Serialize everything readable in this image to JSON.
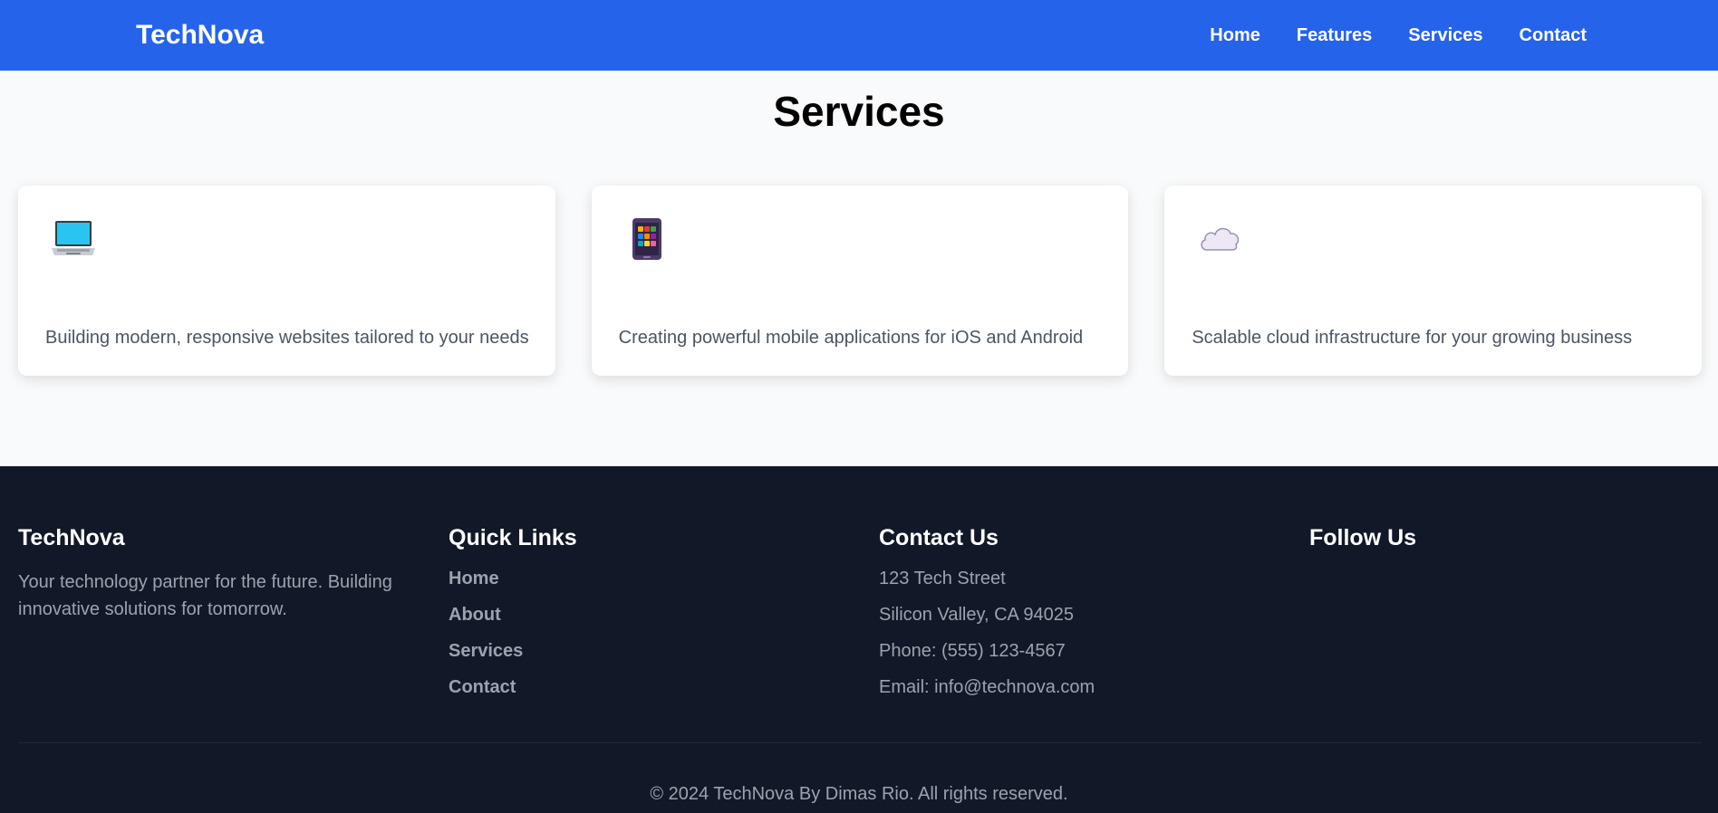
{
  "navbar": {
    "brand": "TechNova",
    "links": [
      {
        "label": "Home"
      },
      {
        "label": "Features"
      },
      {
        "label": "Services"
      },
      {
        "label": "Contact"
      }
    ]
  },
  "services": {
    "title": "Services",
    "cards": [
      {
        "icon": "laptop-icon",
        "text": "Building modern, responsive websites tailored to your needs"
      },
      {
        "icon": "mobile-phone-icon",
        "text": "Creating powerful mobile applications for iOS and Android"
      },
      {
        "icon": "cloud-icon",
        "text": "Scalable cloud infrastructure for your growing business"
      }
    ]
  },
  "footer": {
    "about": {
      "title": "TechNova",
      "description": "Your technology partner for the future. Building innovative solutions for tomorrow."
    },
    "quick_links": {
      "title": "Quick Links",
      "items": [
        {
          "label": "Home"
        },
        {
          "label": "About"
        },
        {
          "label": "Services"
        },
        {
          "label": "Contact"
        }
      ]
    },
    "contact": {
      "title": "Contact Us",
      "address_line1": "123 Tech Street",
      "address_line2": "Silicon Valley, CA 94025",
      "phone": "Phone: (555) 123-4567",
      "email": "Email: info@technova.com"
    },
    "follow": {
      "title": "Follow Us"
    },
    "copyright": "© 2024 TechNova By Dimas Rio. All rights reserved."
  },
  "colors": {
    "primary": "#2563eb",
    "page_background": "#f9fafb",
    "footer_background": "#111827",
    "muted_text": "#9ca3af",
    "card_text": "#4b5563"
  }
}
